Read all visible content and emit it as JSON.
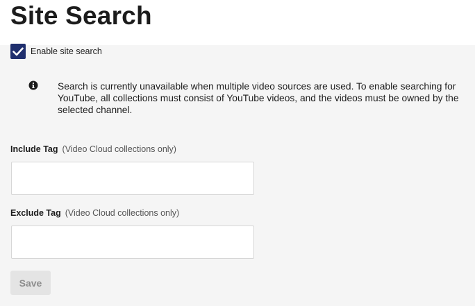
{
  "page": {
    "title": "Site Search"
  },
  "site_search": {
    "enable_label": "Enable site search",
    "enabled": true
  },
  "info": {
    "icon": "info-circle-icon",
    "message": "Search is currently unavailable when multiple video sources are used. To enable searching for YouTube, all collections must consist of YouTube videos, and the videos must be owned by the selected channel."
  },
  "include_tag": {
    "label": "Include Tag",
    "hint": "(Video Cloud collections only)",
    "value": ""
  },
  "exclude_tag": {
    "label": "Exclude Tag",
    "hint": "(Video Cloud collections only)",
    "value": ""
  },
  "actions": {
    "save_label": "Save",
    "save_disabled": true
  },
  "colors": {
    "checkbox_fill": "#1f2f6e",
    "background": "#f5f5f5",
    "header_background": "#ffffff",
    "disabled_button": "#e4e4e4"
  }
}
